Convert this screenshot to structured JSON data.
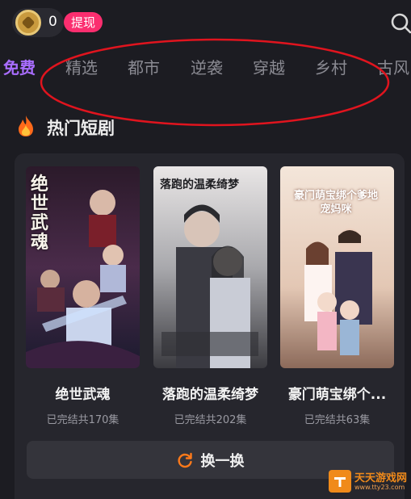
{
  "topbar": {
    "coin_count": "0",
    "withdraw_label": "提现"
  },
  "tabs": [
    {
      "label": "免费",
      "active": true
    },
    {
      "label": "精选"
    },
    {
      "label": "都市"
    },
    {
      "label": "逆袭"
    },
    {
      "label": "穿越"
    },
    {
      "label": "乡村"
    },
    {
      "label": "古风"
    }
  ],
  "section": {
    "title": "热门短剧",
    "dramas": [
      {
        "name": "绝世武魂",
        "meta": "已完结共170集",
        "poster_text": "绝世武魂"
      },
      {
        "name": "落跑的温柔绮梦",
        "meta": "已完结共202集",
        "poster_text": "落跑的温柔绮梦"
      },
      {
        "name": "豪门萌宝绑个...",
        "meta": "已完结共63集",
        "poster_text": "豪门萌宝绑个爹地宠妈咪"
      }
    ],
    "shuffle_label": "换一换"
  },
  "watermark": {
    "name": "天天游戏网",
    "url": "www.tty23.com"
  },
  "colors": {
    "background": "#1c1c22",
    "active_tab": "#a96dff",
    "withdraw": "#fb2e6f",
    "annotation": "#e0141e"
  }
}
